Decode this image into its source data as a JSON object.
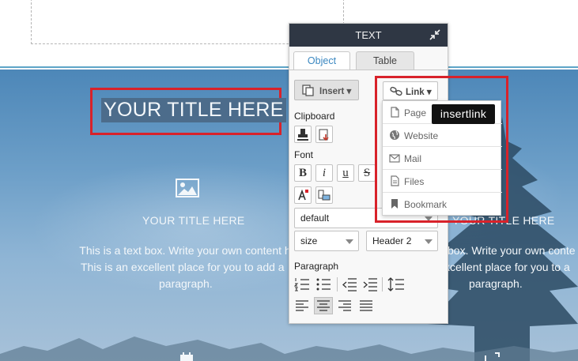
{
  "canvas": {
    "title": "YOUR TITLE HERE",
    "columns": [
      {
        "title": "YOUR TITLE HERE",
        "paragraph": [
          "This is a text box. Write your own content h",
          "This is an excellent place for you to add a",
          "paragraph."
        ]
      },
      {
        "title": "YOUR TITLE HERE",
        "paragraph": [
          "box. Write your own conte",
          "xcellent place for you to a",
          "paragraph."
        ]
      }
    ]
  },
  "panel": {
    "header": "TEXT",
    "tabs": [
      {
        "label": "Object",
        "active": true
      },
      {
        "label": "Table",
        "active": false
      }
    ],
    "insert_label": "Insert",
    "link_label": "Link",
    "clipboard_label": "Clipboard",
    "font_label": "Font",
    "font_buttons": {
      "bold": "B",
      "italic": "i",
      "underline": "u",
      "strike": "S"
    },
    "font_family": "default",
    "size_placeholder": "size",
    "heading": "Header 2",
    "paragraph_label": "Paragraph",
    "active_alignment": "center"
  },
  "link_menu": {
    "items": [
      {
        "label": "Page",
        "icon": "page-icon"
      },
      {
        "label": "Website",
        "icon": "globe-icon"
      },
      {
        "label": "Mail",
        "icon": "mail-icon"
      },
      {
        "label": "Files",
        "icon": "file-icon"
      },
      {
        "label": "Bookmark",
        "icon": "bookmark-icon"
      }
    ]
  },
  "tooltip": "insertlink",
  "colors": {
    "highlight_red": "#d8222a",
    "panel_header": "#2f3744",
    "tab_active": "#3a87c0",
    "title_selection": "#4c6c8b"
  }
}
